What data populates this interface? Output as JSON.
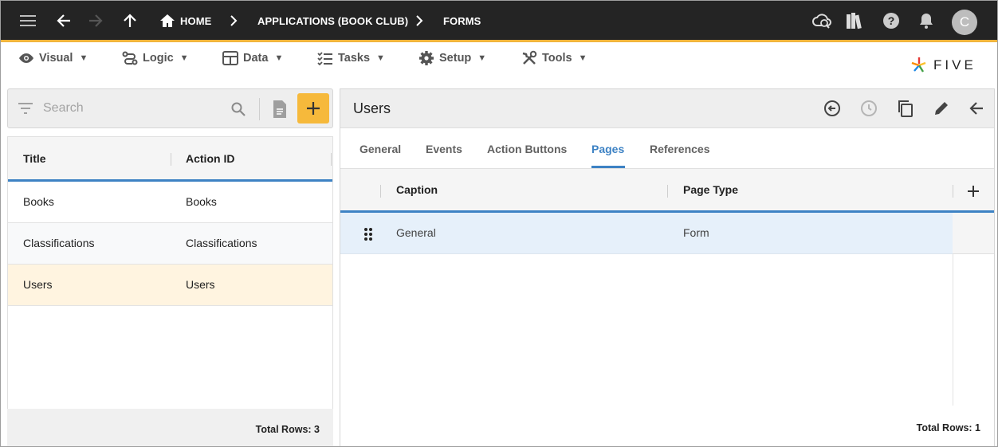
{
  "appbar": {
    "breadcrumbs": [
      "HOME",
      "APPLICATIONS (BOOK CLUB)",
      "FORMS"
    ],
    "avatar_initial": "C"
  },
  "menu": {
    "items": [
      {
        "label": "Visual",
        "icon": "eye-icon"
      },
      {
        "label": "Logic",
        "icon": "logic-icon"
      },
      {
        "label": "Data",
        "icon": "table-icon"
      },
      {
        "label": "Tasks",
        "icon": "checklist-icon"
      },
      {
        "label": "Setup",
        "icon": "gear-icon"
      },
      {
        "label": "Tools",
        "icon": "tools-icon"
      }
    ],
    "caret": "▼",
    "logo_text": "FIVE"
  },
  "left": {
    "search_placeholder": "Search",
    "columns": [
      "Title",
      "Action ID"
    ],
    "rows": [
      {
        "title": "Books",
        "action_id": "Books"
      },
      {
        "title": "Classifications",
        "action_id": "Classifications"
      },
      {
        "title": "Users",
        "action_id": "Users",
        "selected": true
      }
    ],
    "total_rows": "Total Rows: 3"
  },
  "right": {
    "title": "Users",
    "tabs": [
      "General",
      "Events",
      "Action Buttons",
      "Pages",
      "References"
    ],
    "active_tab": "Pages",
    "columns": [
      "Caption",
      "Page Type"
    ],
    "rows": [
      {
        "caption": "General",
        "page_type": "Form"
      }
    ],
    "total_rows": "Total Rows: 1"
  },
  "colors": {
    "appbar_bg": "#242424",
    "accent_orange": "#f6b93b",
    "accent_blue": "#3d82c4",
    "selected_row": "#fff4e0",
    "highlight_row": "#e6f0fa"
  }
}
